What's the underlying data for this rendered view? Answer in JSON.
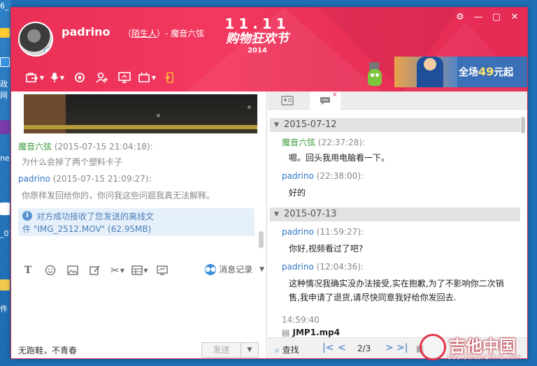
{
  "desktop": {
    "labels": [
      "6_",
      "政",
      "网",
      "ne",
      "件",
      "_07"
    ]
  },
  "window": {
    "contact_name": "padrino",
    "relation_prefix": "（",
    "relation_link": "陌生人",
    "relation_suffix": "）- 魔音六弦",
    "banner": {
      "big": "11.11",
      "mid": "购物狂欢节",
      "year": "2014"
    },
    "ad": {
      "prefix": "全场",
      "number": "49",
      "suffix": "元起"
    },
    "controls": {
      "settings": "⚙",
      "minimize": "—",
      "maximize": "▢",
      "close": "✕"
    },
    "toolbar": [
      "file-transfer-icon",
      "voice-call-icon",
      "video-call-icon",
      "add-contact-icon",
      "screen-share-icon",
      "remote-assist-icon",
      "phone-transfer-icon"
    ]
  },
  "left_chat": {
    "messages": [
      {
        "name": "魔音六弦",
        "time": "(2015-07-15 21:04:18):",
        "body": "为什么会掉了两个塑料卡子"
      },
      {
        "name": "padrino",
        "time": "(2015-07-15 21:09:27):",
        "body": "你原样发回给你的，你问我这些问题我真无法解释。"
      }
    ],
    "notice_line1": "对方成功接收了您发送的离线文",
    "notice_line2": "件 \"IMG_2512.MOV\" (62.95MB)",
    "history_label": "消息记录",
    "signature": "无跑鞋，不青春",
    "send_label": "发送"
  },
  "right_history": {
    "dates": [
      "2015-07-12",
      "2015-07-13"
    ],
    "messages": [
      {
        "name": "魔音六弦",
        "time": "(22:37:28):",
        "body": "嗯。回头我用电脑看一下。"
      },
      {
        "name": "padrino",
        "time": "(22:38:00):",
        "body": "好的"
      },
      {
        "name": "padrino",
        "time": "(11:59:27):",
        "body": "你好,视频看过了吧?"
      },
      {
        "name": "padrino",
        "time": "(12:04:36):",
        "body": "这种情况我确实没办法接受,实在抱歉,为了不影响你二次销",
        "body2": "售,我申请了退货,请尽快同意我好给你发回去."
      }
    ],
    "last_time": "14:59:40",
    "file_name": "JMP1.mp4",
    "footer": {
      "search": "查找",
      "page": "2/3",
      "delete": "删"
    }
  },
  "watermark": {
    "title": "吉他中国",
    "url": "bbs.GuitarChina.com"
  },
  "colors": {
    "header": "#ea2f57",
    "link_blue": "#2f76c2",
    "name_green": "#3c9a3c"
  }
}
